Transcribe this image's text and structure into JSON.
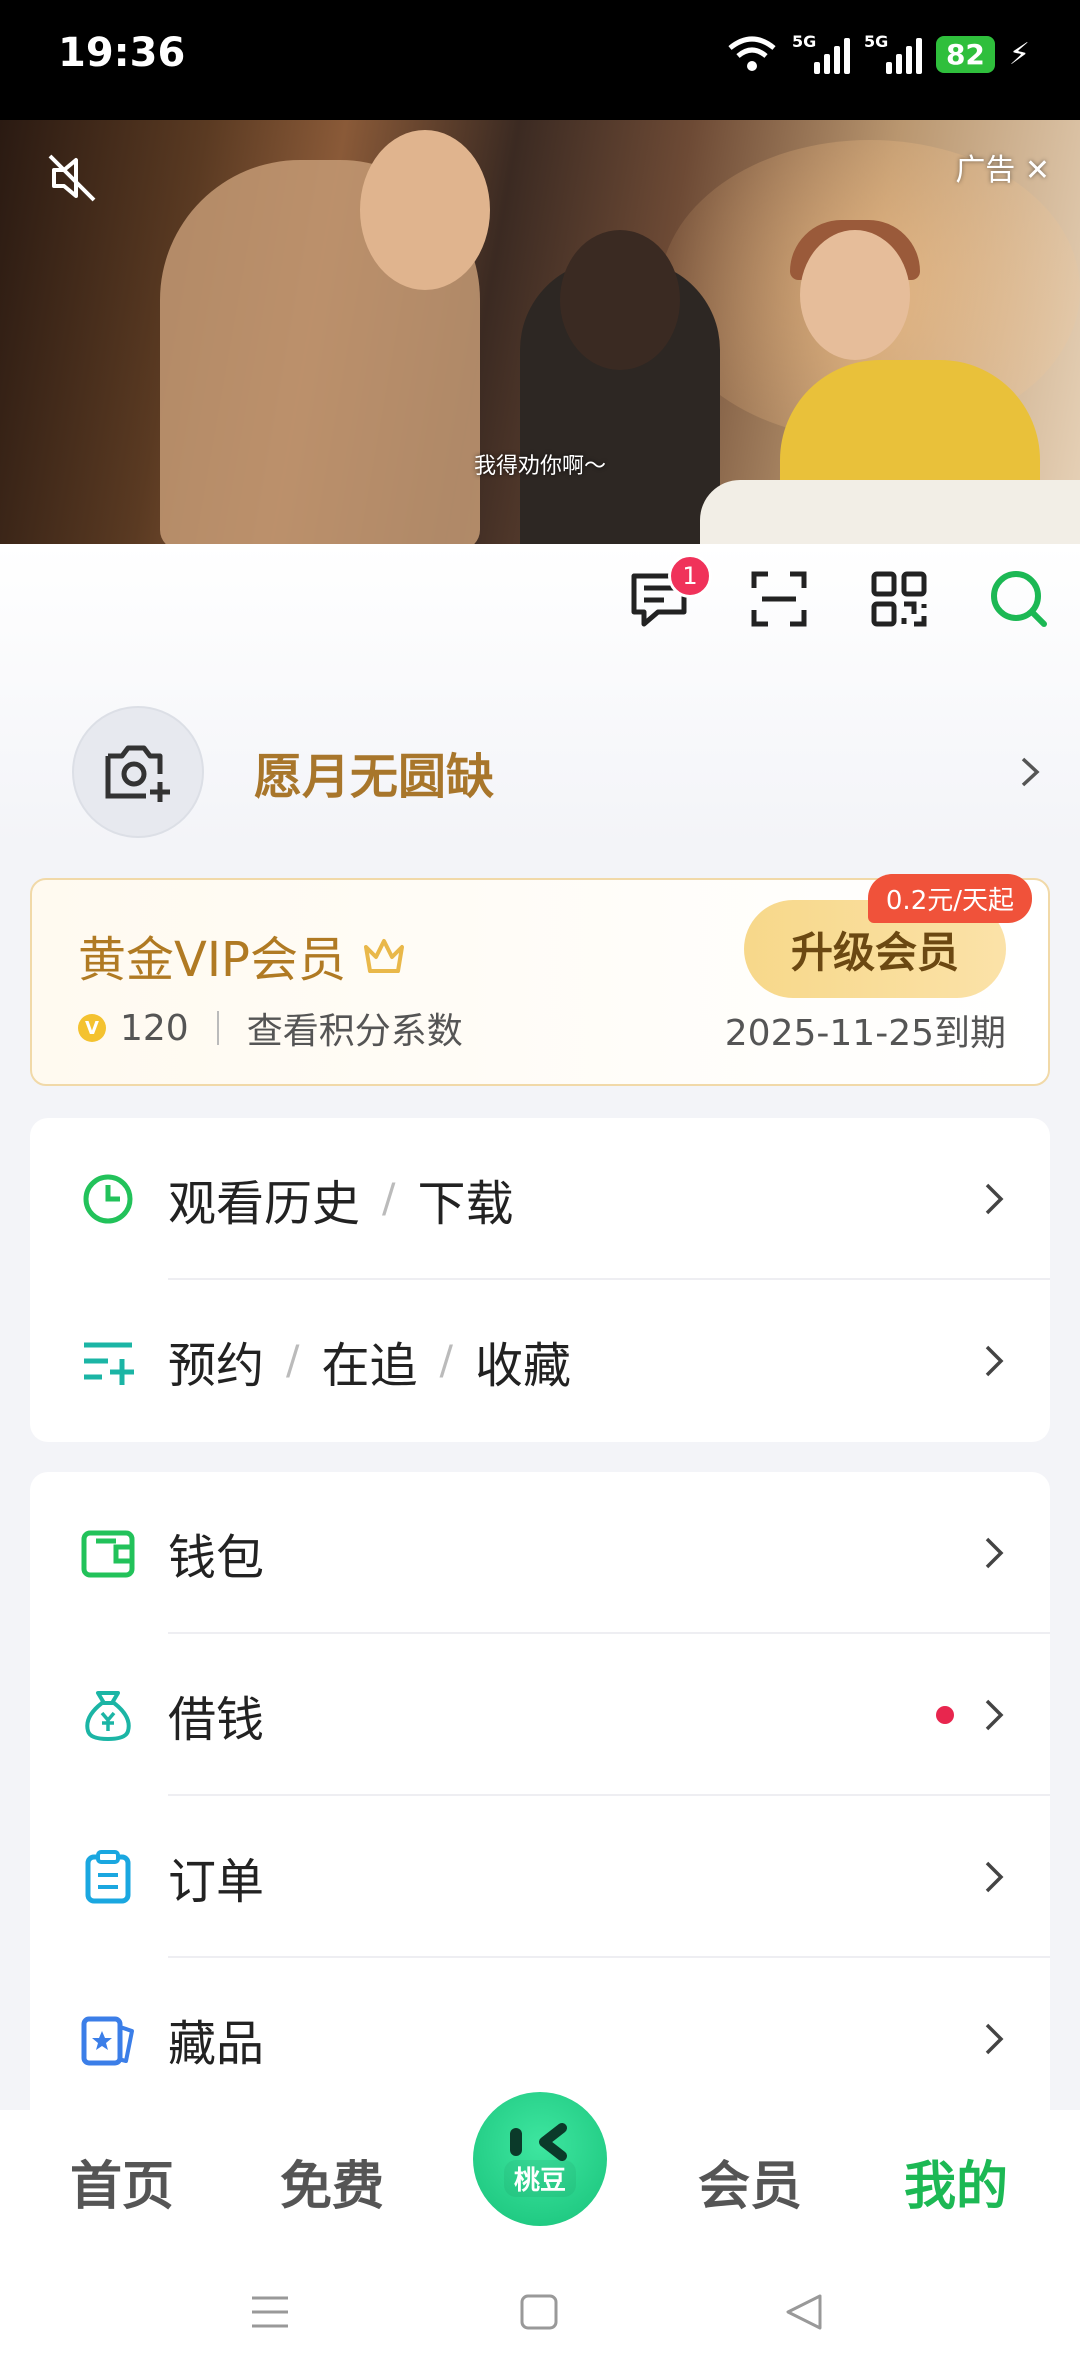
{
  "status": {
    "time": "19:36",
    "battery": "82",
    "net1": "5G",
    "net2": "5G"
  },
  "ad": {
    "label": "广告 ✕",
    "subtitle": "我得劝你啊～"
  },
  "notifications": {
    "badge": "1"
  },
  "profile": {
    "nickname": "愿月无圆缺"
  },
  "vip": {
    "title": "黄金VIP会员",
    "points": "120",
    "points_link": "查看积分系数",
    "upgrade_label": "升级会员",
    "price_tag": "0.2元/天起",
    "expiry": "2025-11-25到期"
  },
  "menu1": {
    "history": {
      "a": "观看历史",
      "b": "下载"
    },
    "follow": {
      "a": "预约",
      "b": "在追",
      "c": "收藏"
    }
  },
  "menu2": {
    "wallet": "钱包",
    "borrow": "借钱",
    "orders": "订单",
    "collectibles": "藏品"
  },
  "nav": {
    "home": "首页",
    "free": "免费",
    "center": "桃豆",
    "vip": "会员",
    "mine": "我的"
  },
  "colors": {
    "accent": "#1cb854",
    "gold": "#b07a23",
    "badge": "#f0325a"
  }
}
